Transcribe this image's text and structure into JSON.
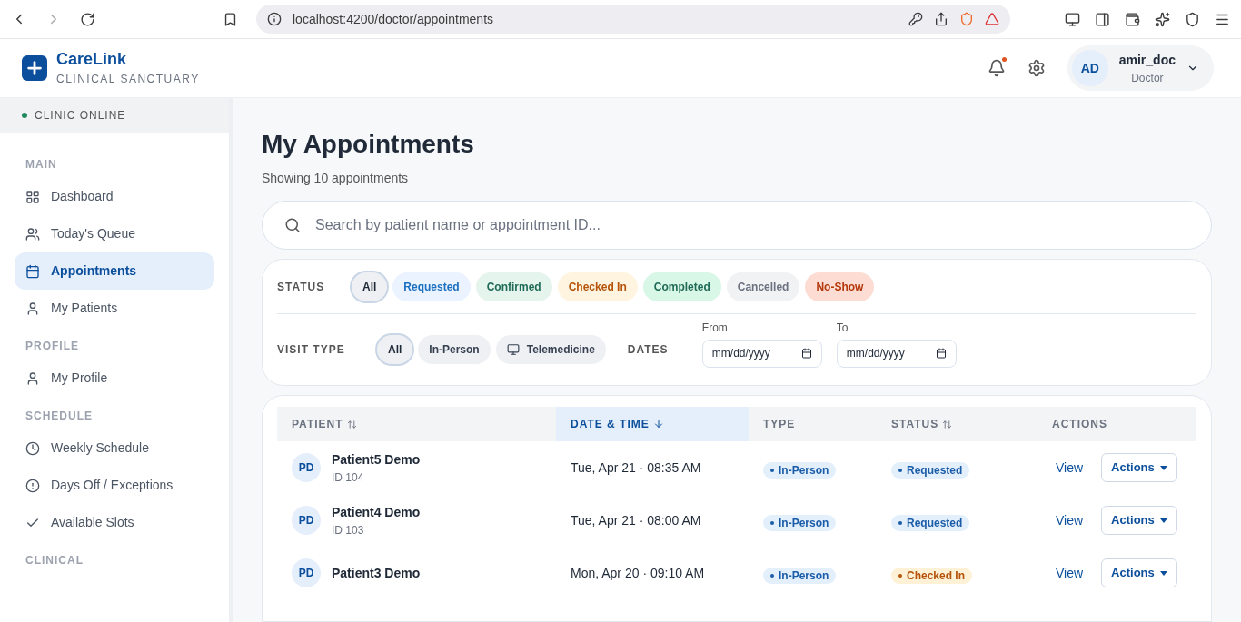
{
  "browser": {
    "url": "localhost:4200/doctor/appointments"
  },
  "brand": {
    "name": "CareLink",
    "tagline": "CLINICAL SANCTUARY"
  },
  "header": {
    "has_notification": true,
    "user": {
      "initials": "AD",
      "name": "amir_doc",
      "role": "Doctor"
    }
  },
  "sidebar": {
    "status": "CLINIC ONLINE",
    "sections": [
      {
        "title": "MAIN",
        "items": [
          {
            "label": "Dashboard",
            "selected": false
          },
          {
            "label": "Today's Queue",
            "selected": false
          },
          {
            "label": "Appointments",
            "selected": true
          },
          {
            "label": "My Patients",
            "selected": false
          }
        ]
      },
      {
        "title": "PROFILE",
        "items": [
          {
            "label": "My Profile",
            "selected": false
          }
        ]
      },
      {
        "title": "SCHEDULE",
        "items": [
          {
            "label": "Weekly Schedule",
            "selected": false
          },
          {
            "label": "Days Off / Exceptions",
            "selected": false
          },
          {
            "label": "Available Slots",
            "selected": false
          }
        ]
      },
      {
        "title": "CLINICAL"
      }
    ]
  },
  "page": {
    "title": "My Appointments",
    "subtitle": "Showing 10 appointments"
  },
  "search": {
    "placeholder": "Search by patient name or appointment ID..."
  },
  "filters": {
    "status_label": "STATUS",
    "status": [
      {
        "label": "All",
        "kind": "all",
        "selected": true
      },
      {
        "label": "Requested",
        "kind": "requested",
        "selected": false
      },
      {
        "label": "Confirmed",
        "kind": "confirmed",
        "selected": false
      },
      {
        "label": "Checked In",
        "kind": "checked",
        "selected": false
      },
      {
        "label": "Completed",
        "kind": "completed",
        "selected": false
      },
      {
        "label": "Cancelled",
        "kind": "cancelled",
        "selected": false
      },
      {
        "label": "No-Show",
        "kind": "noshow",
        "selected": false
      }
    ],
    "visit_label": "VISIT TYPE",
    "visit": [
      {
        "label": "All",
        "selected": true
      },
      {
        "label": "In-Person",
        "selected": false
      },
      {
        "label": "Telemedicine",
        "selected": false
      }
    ],
    "dates_label": "DATES",
    "from": {
      "label": "From",
      "placeholder": "mm/dd/yyyy"
    },
    "to": {
      "label": "To",
      "placeholder": "mm/dd/yyyy"
    }
  },
  "table": {
    "columns": [
      {
        "label": "PATIENT",
        "selected": false
      },
      {
        "label": "DATE & TIME",
        "selected": true
      },
      {
        "label": "TYPE",
        "selected": false
      },
      {
        "label": "STATUS",
        "selected": false
      },
      {
        "label": "ACTIONS",
        "selected": false
      }
    ],
    "rows": [
      {
        "initials": "PD",
        "name": "Patient5 Demo",
        "id": "ID 104",
        "datetime": "Tue, Apr 21 · 08:35 AM",
        "type": "In-Person",
        "status": "Requested",
        "kind": "requested",
        "view": "View",
        "actions": "Actions"
      },
      {
        "initials": "PD",
        "name": "Patient4 Demo",
        "id": "ID 103",
        "datetime": "Tue, Apr 21 · 08:00 AM",
        "type": "In-Person",
        "status": "Requested",
        "kind": "requested",
        "view": "View",
        "actions": "Actions"
      },
      {
        "initials": "PD",
        "name": "Patient3 Demo",
        "datetime": "Mon, Apr 20 · 09:10 AM",
        "type": "In-Person",
        "status": "Checked In",
        "kind": "checked",
        "view": "View",
        "actions": "Actions"
      }
    ]
  }
}
